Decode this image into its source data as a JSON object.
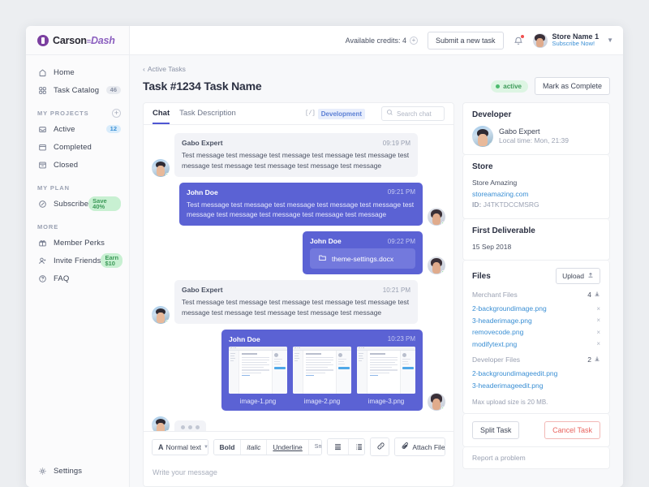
{
  "brand": {
    "name_dark": "Carson",
    "name_sep": "=",
    "name_light": "Dash"
  },
  "sidebar": {
    "primary": [
      {
        "label": "Home",
        "icon": "home-icon",
        "badge": null
      },
      {
        "label": "Task Catalog",
        "icon": "grid-icon",
        "badge": "46",
        "badge_kind": "gray"
      }
    ],
    "projects_title": "MY PROJECTS",
    "projects": [
      {
        "label": "Active",
        "icon": "inbox-icon",
        "badge": "12",
        "badge_kind": "blue"
      },
      {
        "label": "Completed",
        "icon": "folder-icon",
        "badge": null
      },
      {
        "label": "Closed",
        "icon": "archive-icon",
        "badge": null
      }
    ],
    "plan_title": "MY PLAN",
    "plan": [
      {
        "label": "Subscribe",
        "icon": "circle-slash-icon",
        "badge": "Save 40%",
        "badge_kind": "green"
      }
    ],
    "more_title": "MORE",
    "more": [
      {
        "label": "Member Perks",
        "icon": "gift-icon",
        "badge": null
      },
      {
        "label": "Invite Friends",
        "icon": "user-plus-icon",
        "badge": "Earn $10",
        "badge_kind": "green"
      },
      {
        "label": "FAQ",
        "icon": "question-circle-icon",
        "badge": null
      }
    ],
    "settings": {
      "label": "Settings",
      "icon": "gear-icon"
    }
  },
  "topbar": {
    "credits_label": "Available credits: 4",
    "submit_button": "Submit a new task",
    "account_name": "Store Name 1",
    "account_sub": "Subscribe Now!"
  },
  "header": {
    "breadcrumb": "Active Tasks",
    "title": "Task #1234 Task Name",
    "status": "active",
    "complete_button": "Mark as Complete"
  },
  "chat": {
    "tabs": [
      {
        "label": "Chat",
        "active": true
      },
      {
        "label": "Task Description",
        "active": false
      }
    ],
    "dev_tag": "Development",
    "code_icon_glyph": "[/]",
    "search_placeholder": "Search chat",
    "search_value": "",
    "messages": [
      {
        "author": "Gabo Expert",
        "time": "09:19 PM",
        "direction": "in",
        "text": "Test message test message test message test message test message test message test message test message test message test message"
      },
      {
        "author": "John Doe",
        "time": "09:21 PM",
        "direction": "out",
        "text": "Test message test message test message test message test message test message test message test message test message test message"
      },
      {
        "author": "John Doe",
        "time": "09:22 PM",
        "direction": "out",
        "file": "theme-settings.docx"
      },
      {
        "author": "Gabo Expert",
        "time": "10:21 PM",
        "direction": "in",
        "text": "Test message test message test message test message test message test message test message test message test message test message"
      },
      {
        "author": "John Doe",
        "time": "10:23 PM",
        "direction": "out",
        "images": [
          "image-1.png",
          "image-2.png",
          "image-3.png"
        ]
      }
    ],
    "composer": {
      "style_select": "Normal text",
      "bold": "Bold",
      "italic": "italic",
      "underline": "Underline",
      "small": "Small",
      "attach": "Attach File",
      "placeholder": "Write your message"
    }
  },
  "panel": {
    "developer_title": "Developer",
    "developer_name": "Gabo Expert",
    "developer_localtime": "Local time: Mon, 21:39",
    "store_title": "Store",
    "store_name": "Store Amazing",
    "store_url": "storeamazing.com",
    "store_id_label": "ID:",
    "store_id": "J4TKTDCCMSRG",
    "deliverable_title": "First Deliverable",
    "deliverable_date": "15 Sep 2018",
    "files_title": "Files",
    "upload_button": "Upload",
    "merchant_label": "Merchant Files",
    "merchant_count": "4",
    "merchant_files": [
      "2-backgroundimage.png",
      "3-headerimage.png",
      "removecode.png",
      "modifytext.png"
    ],
    "developer_label": "Developer Files",
    "developer_count": "2",
    "developer_files": [
      "2-backgroundimageedit.png",
      "3-headerimageedit.png"
    ],
    "max_upload": "Max upload size is 20 MB.",
    "split_button": "Split Task",
    "cancel_button": "Cancel Task",
    "report_link": "Report a problem"
  },
  "colors": {
    "accent_purple": "#5b62d4",
    "link_blue": "#3a8fd4",
    "status_green": "#4cbb6e",
    "danger_red": "#e8635e",
    "brand_purple": "#7b3fa0"
  }
}
